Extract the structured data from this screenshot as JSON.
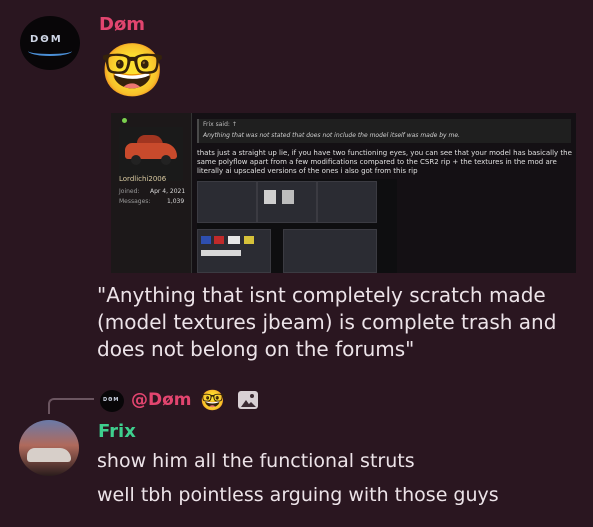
{
  "message1": {
    "author": "Døm",
    "author_color": "#e2456f",
    "avatar_text": "DΘM",
    "emoji": "🤓",
    "embed": {
      "username": "Lordlichi2006",
      "joined_label": "Joined:",
      "joined_value": "Apr 4, 2021",
      "messages_label": "Messages:",
      "messages_value": "1,039",
      "quote_header": "Frix said: ↑",
      "quote_body": "Anything that was not stated that does not include the model itself was made by me.",
      "post_text": "thats just a straight up lie, if you have two functioning eyes, you can see that your model has basically the same polyflow apart from a few modifications compared to the CSR2 rip + the textures in the mod are literally ai upscaled versions of the ones i also got from this rip"
    },
    "text": "\"Anything that isnt completely scratch made (model textures jbeam) is complete trash and does not belong on the forums\""
  },
  "reply": {
    "replied_to": "@Døm",
    "emoji": "🤓",
    "attachment_icon": "image-icon",
    "mini_avatar_text": "DΘM"
  },
  "message2": {
    "author": "Frix",
    "author_color": "#3ecf8e",
    "lines": [
      "show him all the functional struts",
      "well tbh pointless arguing with those guys"
    ]
  }
}
